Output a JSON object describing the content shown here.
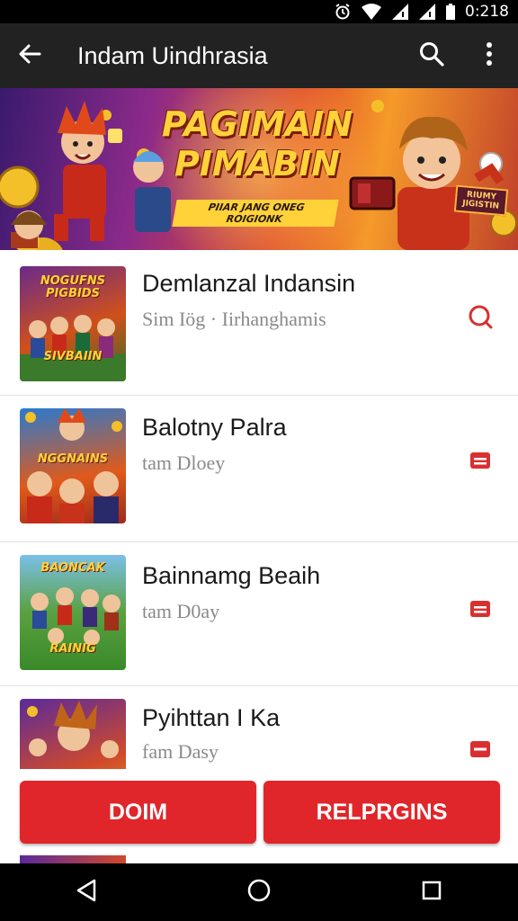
{
  "status_bar": {
    "time": "0:218"
  },
  "app_bar": {
    "title": "Indam Uindhrasia"
  },
  "banner": {
    "title_line1": "PAGIMAIN",
    "title_line2": "PIMABIN",
    "subtitle": "PIIAR JANG ONEG ROIGIONK",
    "sign_text": "RIUMY JIGISTIN"
  },
  "items": [
    {
      "name": "Demlanzal Indansin",
      "meta": "Sim Iög · Iirhanghamis",
      "thumb_label": "NOGUFNS PIGBIDS",
      "thumb_label2": "SIVBAIIN",
      "action_icon": "search-icon"
    },
    {
      "name": "Balotny Palra",
      "meta": "tam Dloey",
      "thumb_label": "NGGNAINS",
      "thumb_label2": "",
      "action_icon": "store-icon"
    },
    {
      "name": "Bainnamg Beaih",
      "meta": "tam D0ay",
      "thumb_label": "BAONCAK",
      "thumb_label2": "RAINIG",
      "action_icon": "store-icon"
    },
    {
      "name": "Pyihttan I Ka",
      "meta": "fam Dasy",
      "thumb_label": "",
      "thumb_label2": "",
      "action_icon": "store-icon"
    }
  ],
  "buttons": {
    "left": "DOIM",
    "right": "RELPRGINS"
  },
  "colors": {
    "accent": "#e0262a",
    "toolbar": "#222222"
  }
}
